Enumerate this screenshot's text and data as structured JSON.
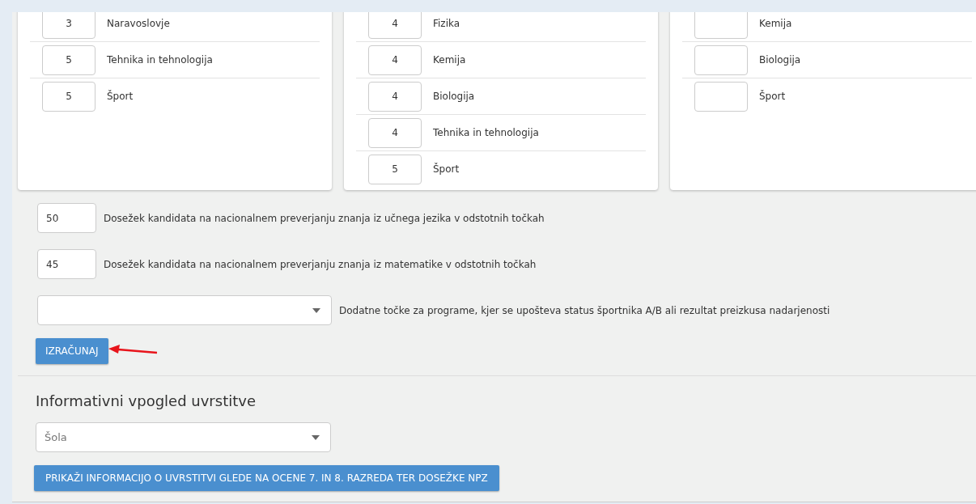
{
  "grade_cards": [
    {
      "rows": [
        {
          "grade": "3",
          "subject": "Naravoslovje"
        },
        {
          "grade": "5",
          "subject": "Tehnika in tehnologija"
        },
        {
          "grade": "5",
          "subject": "Šport"
        }
      ]
    },
    {
      "rows": [
        {
          "grade": "4",
          "subject": "Fizika"
        },
        {
          "grade": "4",
          "subject": "Kemija"
        },
        {
          "grade": "4",
          "subject": "Biologija"
        },
        {
          "grade": "4",
          "subject": "Tehnika in tehnologija"
        },
        {
          "grade": "5",
          "subject": "Šport"
        }
      ]
    },
    {
      "rows": [
        {
          "grade": "",
          "subject": "Kemija"
        },
        {
          "grade": "",
          "subject": "Biologija"
        },
        {
          "grade": "",
          "subject": "Šport"
        }
      ]
    }
  ],
  "npz_scores": [
    {
      "value": "50",
      "label": "Dosežek kandidata na nacionalnem preverjanju znanja iz učnega jezika v odstotnih točkah"
    },
    {
      "value": "45",
      "label": "Dosežek kandidata na nacionalnem preverjanju znanja iz matematike v odstotnih točkah"
    }
  ],
  "extra_points": {
    "label": "Dodatne točke za programe, kjer se upošteva status športnika A/B ali rezultat preizkusa nadarjenosti"
  },
  "calculate_button": "IZRAČUNAJ",
  "ranking_section": {
    "title": "Informativni vpogled uvrstitve",
    "school_select": {
      "placeholder": "Šola"
    },
    "show_button": "PRIKAŽI INFORMACIJO O UVRSTITVI GLEDE NA OCENE 7. IN 8. RAZREDA TER DOSEŽKE NPZ"
  }
}
